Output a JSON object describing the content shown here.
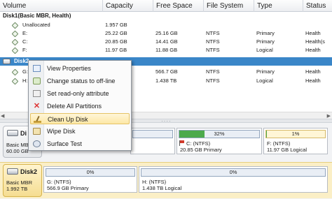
{
  "table": {
    "columns": [
      "Volume",
      "Capacity",
      "Free Space",
      "File System",
      "Type",
      "Status"
    ],
    "disk1": {
      "label": "Disk1(Basic MBR, Health)"
    },
    "disk1_parts": [
      {
        "volume": "Unallocated",
        "capacity": "1.957 GB",
        "free": "",
        "fs": "",
        "type": "",
        "status": ""
      },
      {
        "volume": "E:",
        "capacity": "25.22 GB",
        "free": "25.16 GB",
        "fs": "NTFS",
        "type": "Primary",
        "status": "Health"
      },
      {
        "volume": "C:",
        "capacity": "20.85 GB",
        "free": "14.41 GB",
        "fs": "NTFS",
        "type": "Primary",
        "status": "Health(s"
      },
      {
        "volume": "F:",
        "capacity": "11.97 GB",
        "free": "11.88 GB",
        "fs": "NTFS",
        "type": "Logical",
        "status": "Health"
      }
    ],
    "disk2": {
      "label": "Disk2"
    },
    "disk2_parts": [
      {
        "volume": "G:",
        "capacity": "",
        "free": "566.7 GB",
        "fs": "NTFS",
        "type": "Primary",
        "status": "Health"
      },
      {
        "volume": "H:",
        "capacity": "",
        "free": "1.438 TB",
        "fs": "NTFS",
        "type": "Logical",
        "status": "Health"
      }
    ]
  },
  "context_menu": {
    "items": [
      {
        "label": "View Properties",
        "icon": "properties-icon"
      },
      {
        "label": "Change status to off-line",
        "icon": "status-icon"
      },
      {
        "label": "Set read-only attribute",
        "icon": "read-only-icon"
      },
      {
        "label": "Delete All Partitions",
        "icon": "delete-icon"
      },
      {
        "label": "Clean Up Disk",
        "icon": "clean-icon",
        "highlighted": true
      },
      {
        "label": "Wipe Disk",
        "icon": "wipe-icon"
      },
      {
        "label": "Surface Test",
        "icon": "surface-test-icon"
      }
    ]
  },
  "disk_map": {
    "disk1": {
      "name": "Di",
      "info1": "Basic MBR",
      "info2": "60.00 GB",
      "partitions": [
        {
          "pct": "",
          "pct_value": 0,
          "line1": "",
          "line2": ""
        },
        {
          "pct": "32%",
          "pct_value": 32,
          "line1": "C: (NTFS)",
          "line2": "20.85 GB Primary",
          "flag": true
        },
        {
          "pct": "1%",
          "pct_value": 1,
          "line1": "F: (NTFS)",
          "line2": "11.97 GB Logical"
        }
      ]
    },
    "disk2": {
      "name": "Disk2",
      "info1": "Basic MBR",
      "info2": "1.992 TB",
      "partitions": [
        {
          "pct": "0%",
          "pct_value": 0,
          "line1": "G: (NTFS)",
          "line2": "566.9 GB Primary"
        },
        {
          "pct": "0%",
          "pct_value": 0,
          "line1": "H: (NTFS)",
          "line2": "1.438 TB Logical"
        }
      ]
    }
  },
  "colors": {
    "selection": "#3a86c8",
    "menu_highlight": "#fde7a6",
    "usage_fill": "#4caa4c",
    "selected_disk_band": "#fbefc6"
  }
}
